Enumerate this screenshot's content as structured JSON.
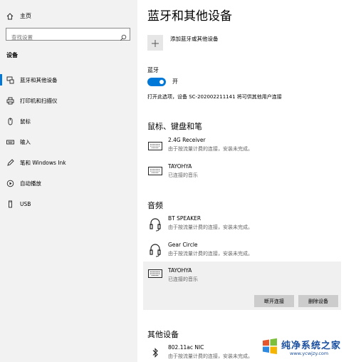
{
  "sidebar": {
    "home_label": "主页",
    "search_placeholder": "查找设置",
    "section_title": "设备",
    "items": [
      {
        "label": "蓝牙和其他设备",
        "icon": "bluetooth-devices-icon",
        "active": true
      },
      {
        "label": "打印机和扫描仪",
        "icon": "printer-icon"
      },
      {
        "label": "鼠标",
        "icon": "mouse-icon"
      },
      {
        "label": "输入",
        "icon": "keyboard-icon"
      },
      {
        "label": "笔和 Windows Ink",
        "icon": "pen-icon"
      },
      {
        "label": "自动播放",
        "icon": "autoplay-icon"
      },
      {
        "label": "USB",
        "icon": "usb-icon"
      }
    ]
  },
  "main": {
    "title": "蓝牙和其他设备",
    "add_label": "添加蓝牙或其他设备",
    "bluetooth": {
      "label": "蓝牙",
      "state": "开",
      "description": "打开此选项，设备 SC-202002211141 将可供其他用户连接"
    },
    "groups": {
      "input": {
        "title": "鼠标、键盘和笔",
        "devices": [
          {
            "name": "2.4G Receiver",
            "status": "由于按流量计费的连接，安装未完成。",
            "icon": "keyboard-icon"
          },
          {
            "name": "TAYOHYA",
            "status": "已连接的音乐",
            "icon": "keyboard-icon"
          }
        ]
      },
      "audio": {
        "title": "音频",
        "devices": [
          {
            "name": "BT SPEAKER",
            "status": "由于按流量计费的连接，安装未完成。",
            "icon": "headset-icon"
          },
          {
            "name": "Gear Circle",
            "status": "由于按流量计费的连接，安装未完成。",
            "icon": "headset-icon"
          },
          {
            "name": "TAYOHYA",
            "status": "已连接的音乐",
            "icon": "keyboard-icon"
          }
        ],
        "disconnect_label": "断开连接",
        "remove_label": "删除设备"
      },
      "other": {
        "title": "其他设备",
        "devices": [
          {
            "name": "802.11ac NIC",
            "status": "由于按流量计费的连接，安装未完成。",
            "icon": "bluetooth-icon"
          }
        ]
      }
    }
  },
  "watermark": {
    "title": "纯净系统之家",
    "url": "www.ycwjzy.com"
  },
  "colors": {
    "accent": "#0078d7",
    "sidebar_bg": "#f2f2f2",
    "selected_bg": "#f0f0f0",
    "button_bg": "#cccccc"
  }
}
